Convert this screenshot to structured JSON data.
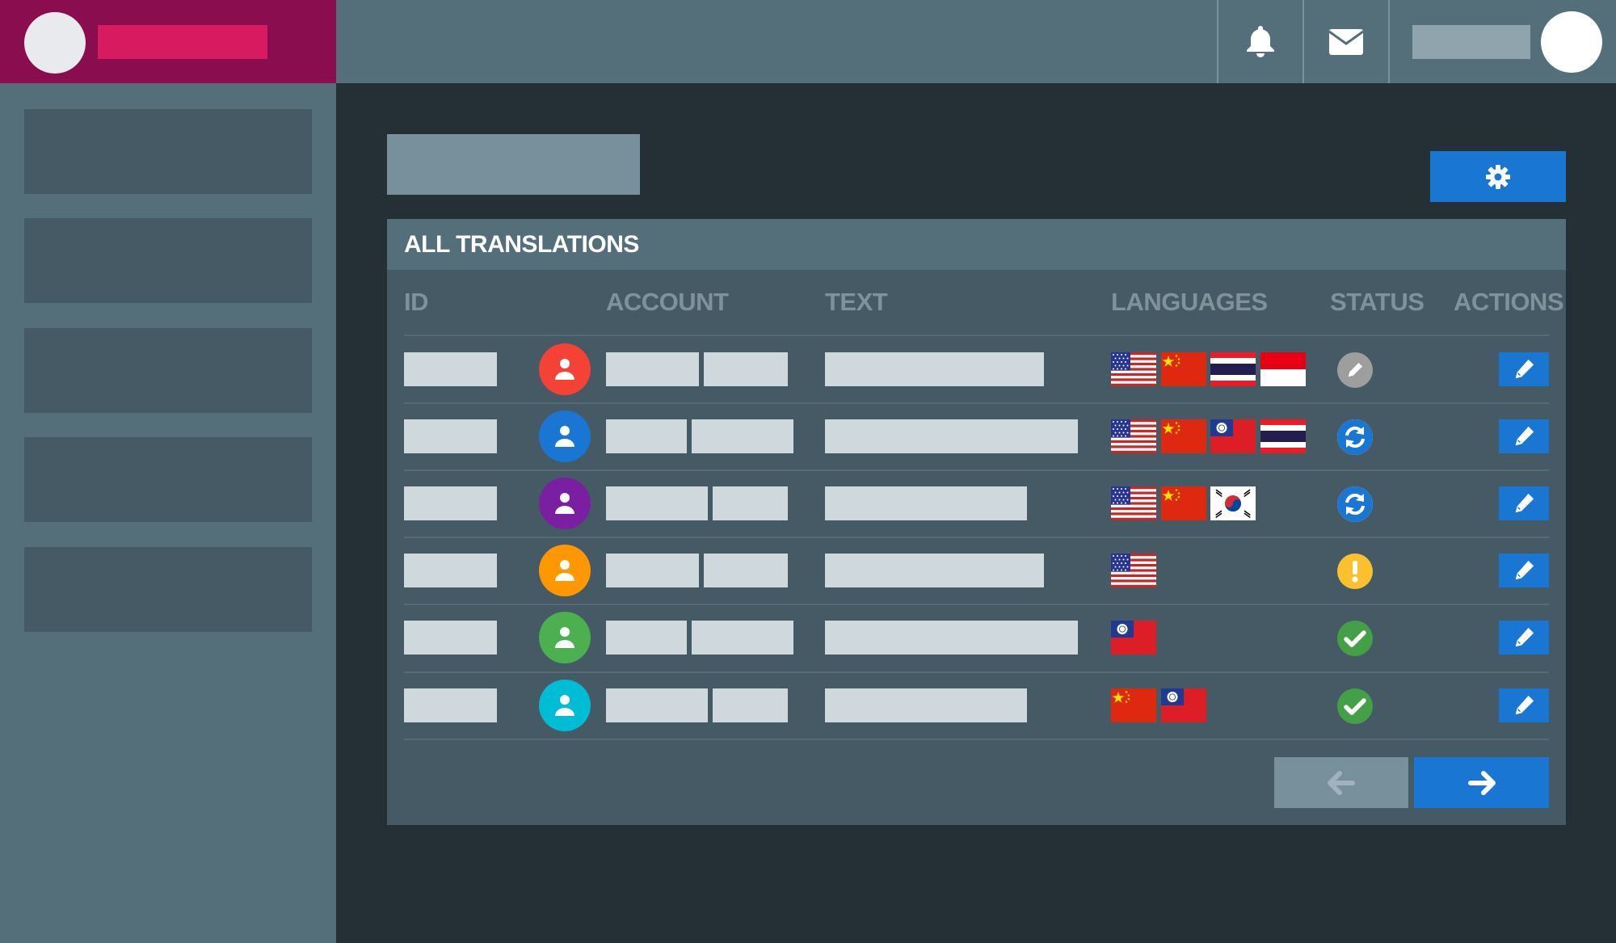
{
  "header": {
    "icons": [
      "bell-icon",
      "mail-icon"
    ]
  },
  "panel": {
    "title": "ALL TRANSLATIONS",
    "columns": [
      "ID",
      "ACCOUNT",
      "TEXT",
      "LANGUAGES",
      "STATUS",
      "ACTIONS"
    ]
  },
  "colors": {
    "brand": "#8a0e4f",
    "accent": "#1976d2",
    "avatar_colors": [
      "#f44336",
      "#1976d2",
      "#7b1fa2",
      "#ff9800",
      "#4caf50",
      "#00bcd4"
    ],
    "status_draft": "#9e9e9e",
    "status_in_progress": "#1976d2",
    "status_warning": "#fbc02d",
    "status_done": "#43a047"
  },
  "rows": [
    {
      "avatar_color": "#f44336",
      "languages": [
        "us",
        "cn",
        "th",
        "id"
      ],
      "status": "draft"
    },
    {
      "avatar_color": "#1976d2",
      "languages": [
        "us",
        "cn",
        "tw",
        "th"
      ],
      "status": "in-progress"
    },
    {
      "avatar_color": "#7b1fa2",
      "languages": [
        "us",
        "cn",
        "kr"
      ],
      "status": "in-progress"
    },
    {
      "avatar_color": "#ff9800",
      "languages": [
        "us"
      ],
      "status": "warning"
    },
    {
      "avatar_color": "#4caf50",
      "languages": [
        "tw"
      ],
      "status": "done"
    },
    {
      "avatar_color": "#00bcd4",
      "languages": [
        "cn",
        "tw"
      ],
      "status": "done"
    }
  ],
  "pagination": {
    "prev_icon": "arrow-left-icon",
    "next_icon": "arrow-right-icon"
  },
  "toolbar": {
    "settings_icon": "gear-icon"
  }
}
